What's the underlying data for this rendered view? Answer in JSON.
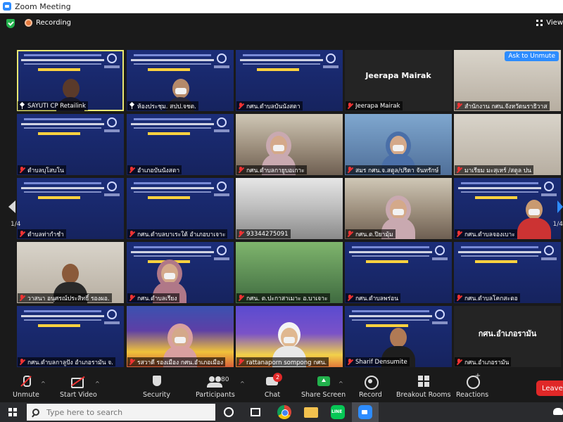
{
  "window": {
    "title": "Zoom Meeting"
  },
  "topbar": {
    "recording_label": "Recording",
    "view_label": "View"
  },
  "gallery": {
    "page_left": "1/4",
    "page_right": "1/4",
    "ask_to_unmute": "Ask to Unmute",
    "tiles": [
      {
        "name": "SAYUTI CP Retailink",
        "pinned": true,
        "muted": false
      },
      {
        "name": "ห้องประชุม. สปป.จชต.",
        "pinned": true,
        "muted": false
      },
      {
        "name": "กศน.ตำบลบันนังสตา",
        "pinned": false,
        "muted": true
      },
      {
        "name": "Jeerapa Mairak",
        "pinned": false,
        "muted": true,
        "big_name": "Jeerapa Mairak"
      },
      {
        "name": "สำนักงาน กศน.จังหวัดนราธิวาส",
        "pinned": false,
        "muted": true
      },
      {
        "name": "ตำบลบุโสบโน",
        "pinned": false,
        "muted": true
      },
      {
        "name": "อำเภอบันนังสตา",
        "pinned": false,
        "muted": true
      },
      {
        "name": "กศน.ตำบลกายูบอเกาะ",
        "pinned": false,
        "muted": true
      },
      {
        "name": "สมร กศน.จ.สตูล/ปริดา จันทรักษ์",
        "pinned": false,
        "muted": true
      },
      {
        "name": "มาเรียม มะสุเหร์ /สตูล ปน",
        "pinned": false,
        "muted": true
      },
      {
        "name": "ตำบลท่ากำชำ",
        "pinned": false,
        "muted": true
      },
      {
        "name": "กศน.ตำบลบาเระใต้ อำเภอบาเจาะ",
        "pinned": false,
        "muted": true
      },
      {
        "name": "93344275091",
        "pinned": false,
        "muted": true
      },
      {
        "name": "กศน.ต.ปิยามุ้ม",
        "pinned": false,
        "muted": true
      },
      {
        "name": "กศน.ตำบลจองเบาะ",
        "pinned": false,
        "muted": true
      },
      {
        "name": "วาสนา อนุศรณ์ประสิทธิ์ รองผอ.",
        "pinned": false,
        "muted": true
      },
      {
        "name": "กศน.ตำบลเรียง",
        "pinned": false,
        "muted": true
      },
      {
        "name": "กศน. ต.ปะกาสาเมาะ อ.บาเจาะ",
        "pinned": false,
        "muted": true
      },
      {
        "name": "กศน.ตำบลพร่อน",
        "pinned": false,
        "muted": true
      },
      {
        "name": "กศน.ตำบลโคกสะตอ",
        "pinned": false,
        "muted": true
      },
      {
        "name": "กศน.ตำบลกาลูปัง อำเภอรามัน จ.",
        "pinned": false,
        "muted": true
      },
      {
        "name": "รสวาดี รองเมือง กศน.อำเภอเมือง",
        "pinned": false,
        "muted": true
      },
      {
        "name": "rattanaporn sompong กศน.",
        "pinned": false,
        "muted": true
      },
      {
        "name": "Sharif Densumite",
        "pinned": false,
        "muted": true
      },
      {
        "name": "กศน.อำเภอรามัน",
        "pinned": false,
        "muted": true,
        "big_name": "กศน.อำเภอรามัน"
      }
    ]
  },
  "toolbar": {
    "unmute": "Unmute",
    "start_video": "Start Video",
    "security": "Security",
    "participants": "Participants",
    "participants_count": "80",
    "chat": "Chat",
    "chat_badge": "2",
    "share_screen": "Share Screen",
    "record": "Record",
    "breakout_rooms": "Breakout Rooms",
    "reactions": "Reactions",
    "leave": "Leave"
  },
  "taskbar": {
    "search_placeholder": "Type here to search"
  },
  "colors": {
    "zoom_blue": "#2d8cff",
    "share_green": "#22b14c",
    "leave_red": "#e02828",
    "active_speaker": "#e8e874"
  }
}
